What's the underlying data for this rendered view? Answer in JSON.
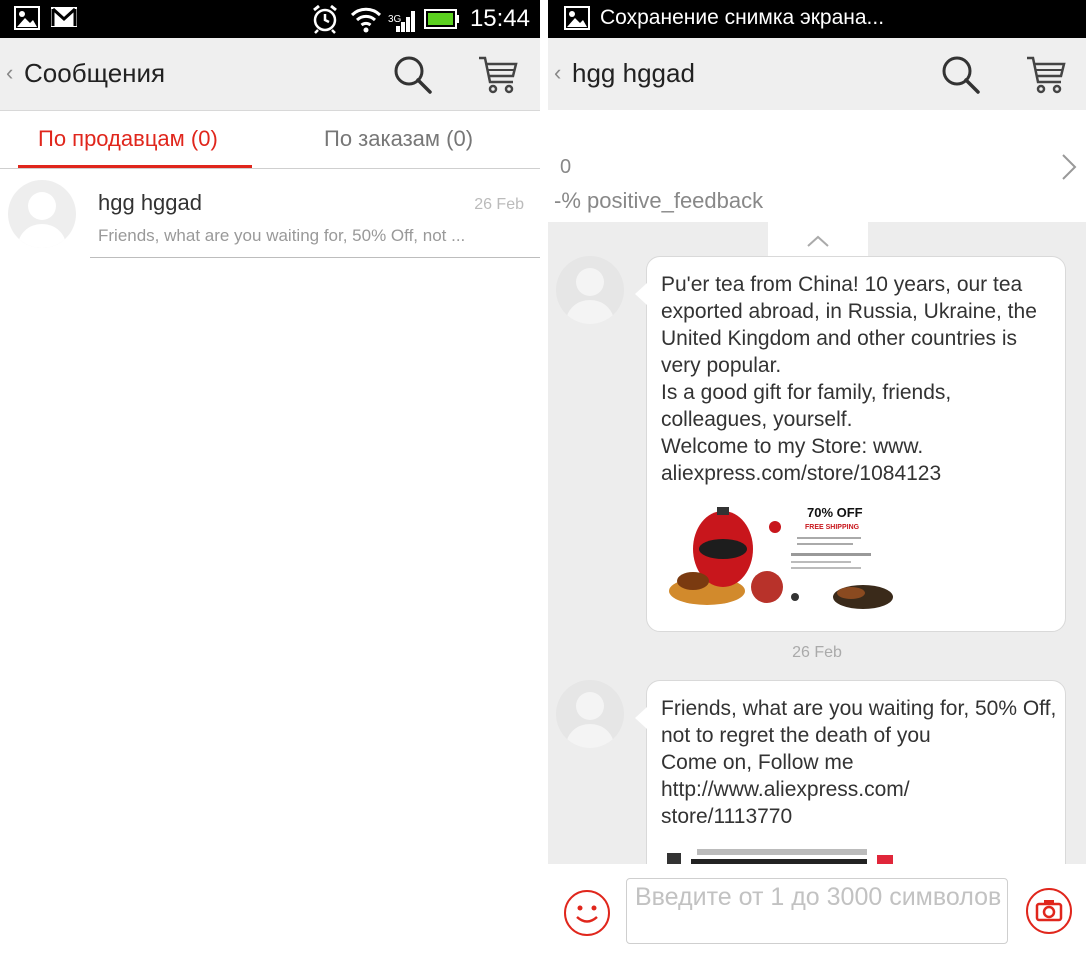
{
  "colors": {
    "accent": "#e0261c",
    "appbar": "#efefef",
    "chat_bg": "#ededed",
    "status_bar": "#000000"
  },
  "left": {
    "status": {
      "time": "15:44",
      "icons": [
        "image-icon",
        "gmail-icon",
        "alarm-icon",
        "wifi-icon",
        "signal-icon",
        "battery-icon"
      ]
    },
    "appbar": {
      "title": "Сообщения"
    },
    "tabs": [
      {
        "label": "По продавцам (0)",
        "active": true
      },
      {
        "label": "По заказам (0)",
        "active": false
      }
    ],
    "conversations": [
      {
        "name": "hgg hggad",
        "date": "26 Feb",
        "preview": "Friends, what are you waiting for,  50% Off, not ..."
      }
    ]
  },
  "right": {
    "status": {
      "text": "Сохранение снимка экрана..."
    },
    "appbar": {
      "title": "hgg hggad"
    },
    "store": {
      "score": "0",
      "feedback": "-%  positive_feedback"
    },
    "messages": [
      {
        "text": "Pu'er tea from China! 10 years, our tea exported abroad,  in Russia, Ukraine, the United Kingdom and other countries is very popular.\nIs a good gift for family, friends, colleagues, yourself.\nWelcome to  my Store: www.\naliexpress.com/store/1084123",
        "image": {
          "headline": "70% OFF",
          "sub": "FREE SHIPPING"
        }
      },
      {
        "text": "Friends, what are you waiting for,  50% Off, not to regret the death of you\nCome on, Follow me\nhttp://www.aliexpress.com/\nstore/1113770"
      }
    ],
    "date_separator": "26 Feb",
    "input": {
      "placeholder": "Введите от 1 до 3000 символов"
    }
  }
}
